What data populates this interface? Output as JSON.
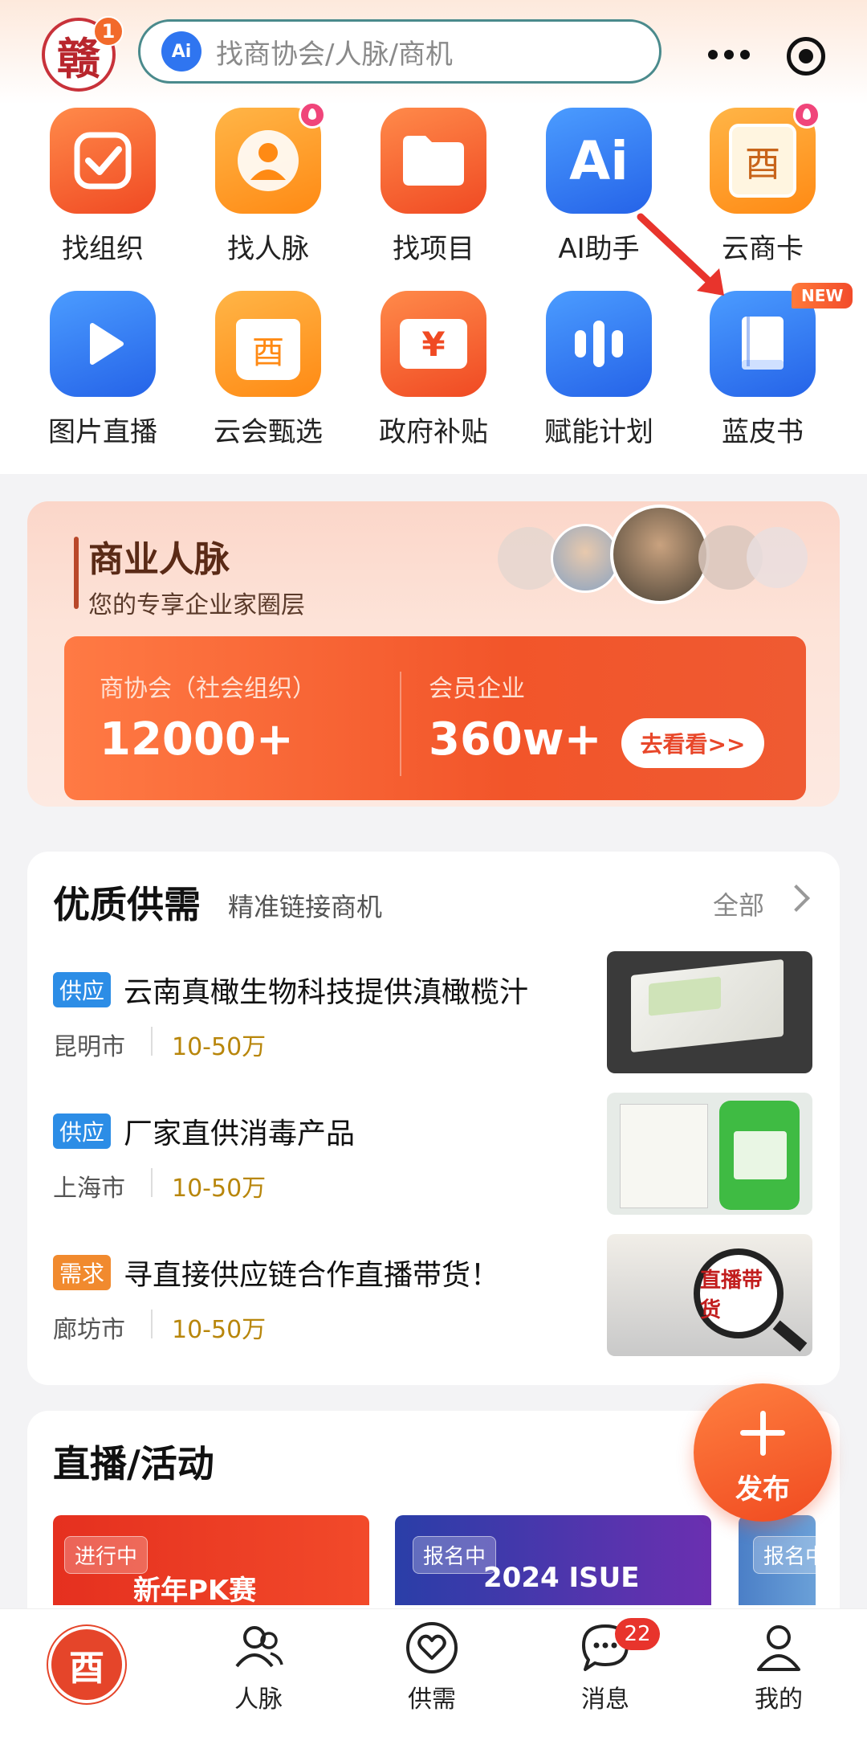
{
  "header": {
    "logo_char": "赣",
    "logo_badge": "1",
    "search_placeholder": "找商协会/人脉/商机",
    "ai_mark": "Ai"
  },
  "grid": {
    "row1": [
      {
        "label": "找组织",
        "icon": "check-icon",
        "color": "orange",
        "hot": false
      },
      {
        "label": "找人脉",
        "icon": "person-icon",
        "color": "amber",
        "hot": true
      },
      {
        "label": "找项目",
        "icon": "folder-icon",
        "color": "orange",
        "hot": false
      },
      {
        "label": "AI助手",
        "icon": "ai-icon",
        "color": "blue",
        "hot": false
      },
      {
        "label": "云商卡",
        "icon": "card-icon",
        "color": "amber",
        "hot": true
      }
    ],
    "row2": [
      {
        "label": "图片直播",
        "icon": "play-icon",
        "color": "blue"
      },
      {
        "label": "云会甄选",
        "icon": "shopping-bag-icon",
        "color": "amber"
      },
      {
        "label": "政府补贴",
        "icon": "yen-ticket-icon",
        "color": "orange"
      },
      {
        "label": "赋能计划",
        "icon": "sound-bars-icon",
        "color": "blue"
      },
      {
        "label": "蓝皮书",
        "icon": "book-icon",
        "color": "blue"
      }
    ],
    "new_tag": "NEW",
    "ai_glyph": "Ai",
    "card_glyph": "酉",
    "bag_glyph": "酉",
    "yen_glyph": "¥"
  },
  "business": {
    "title": "商业人脉",
    "subtitle": "您的专享企业家圈层",
    "stat1_label": "商协会（社会组织）",
    "stat1_value": "12000+",
    "stat2_label": "会员企业",
    "stat2_value": "360w+",
    "button": "去看看>>"
  },
  "supply": {
    "title": "优质供需",
    "subtitle": "精准链接商机",
    "all": "全部",
    "items": [
      {
        "tag": "供应",
        "tag_type": "supply",
        "title": "云南真橄生物科技提供滇橄榄汁",
        "city": "昆明市",
        "price": "10-50万"
      },
      {
        "tag": "供应",
        "tag_type": "supply",
        "title": "厂家直供消毒产品",
        "city": "上海市",
        "price": "10-50万"
      },
      {
        "tag": "需求",
        "tag_type": "demand",
        "title": "寻直接供应链合作直播带货！",
        "city": "廊坊市",
        "price": "10-50万"
      }
    ],
    "thumb3_text": "直播带货"
  },
  "live": {
    "title": "直播/活动",
    "cards": [
      {
        "tag": "进行中",
        "text": "新年PK赛"
      },
      {
        "tag": "报名中",
        "text": "2024 ISUE"
      },
      {
        "tag": "报名中",
        "text": ""
      }
    ]
  },
  "fab": {
    "label": "发布"
  },
  "nav": {
    "home_glyph": "酉",
    "items": [
      {
        "label": "人脉",
        "icon": "people-icon"
      },
      {
        "label": "供需",
        "icon": "heart-hands-icon"
      },
      {
        "label": "消息",
        "icon": "chat-icon"
      },
      {
        "label": "我的",
        "icon": "user-icon"
      }
    ],
    "message_badge": "22"
  },
  "colors": {
    "accent": "#f04a23",
    "blue": "#2563e8",
    "search_border": "#4a8a8c"
  }
}
